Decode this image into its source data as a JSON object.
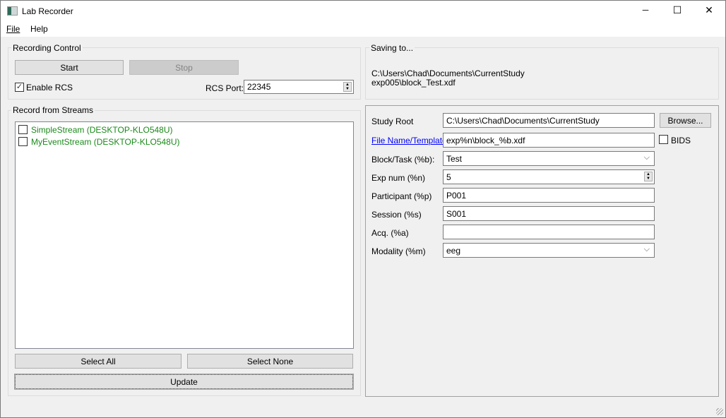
{
  "window": {
    "title": "Lab Recorder",
    "controls": {
      "minimize": "─",
      "maximize": "☐",
      "close": "✕"
    }
  },
  "menu": [
    {
      "label": "File"
    },
    {
      "label": "Help"
    }
  ],
  "recording_control": {
    "title": "Recording Control",
    "start": "Start",
    "stop": "Stop",
    "enable_rcs": "Enable RCS",
    "enable_rcs_checked": true,
    "rcs_port_label": "RCS Port:",
    "rcs_port": "22345"
  },
  "streams": {
    "title": "Record from Streams",
    "items": [
      {
        "label": "SimpleStream (DESKTOP-KLO548U)",
        "checked": false
      },
      {
        "label": "MyEventStream (DESKTOP-KLO548U)",
        "checked": false
      }
    ],
    "select_all": "Select All",
    "select_none": "Select None",
    "update": "Update",
    "stream_color": "#1a8a1a"
  },
  "saving": {
    "title": "Saving to...",
    "line1": "C:\\Users\\Chad\\Documents\\CurrentStudy",
    "line2": "exp005\\block_Test.xdf"
  },
  "form": {
    "study_root_label": "Study Root",
    "study_root": "C:\\Users\\Chad\\Documents\\CurrentStudy",
    "browse": "Browse...",
    "file_template_label": "File Name/Template",
    "file_template": "exp%n\\block_%b.xdf",
    "bids": "BIDS",
    "bids_checked": false,
    "block_label": "Block/Task (%b):",
    "block": "Test",
    "exp_label": "Exp num (%n)",
    "exp": "5",
    "participant_label": "Participant (%p)",
    "participant": "P001",
    "session_label": "Session (%s)",
    "session": "S001",
    "acq_label": "Acq. (%a)",
    "acq": "",
    "modality_label": "Modality (%m)",
    "modality": "eeg"
  }
}
